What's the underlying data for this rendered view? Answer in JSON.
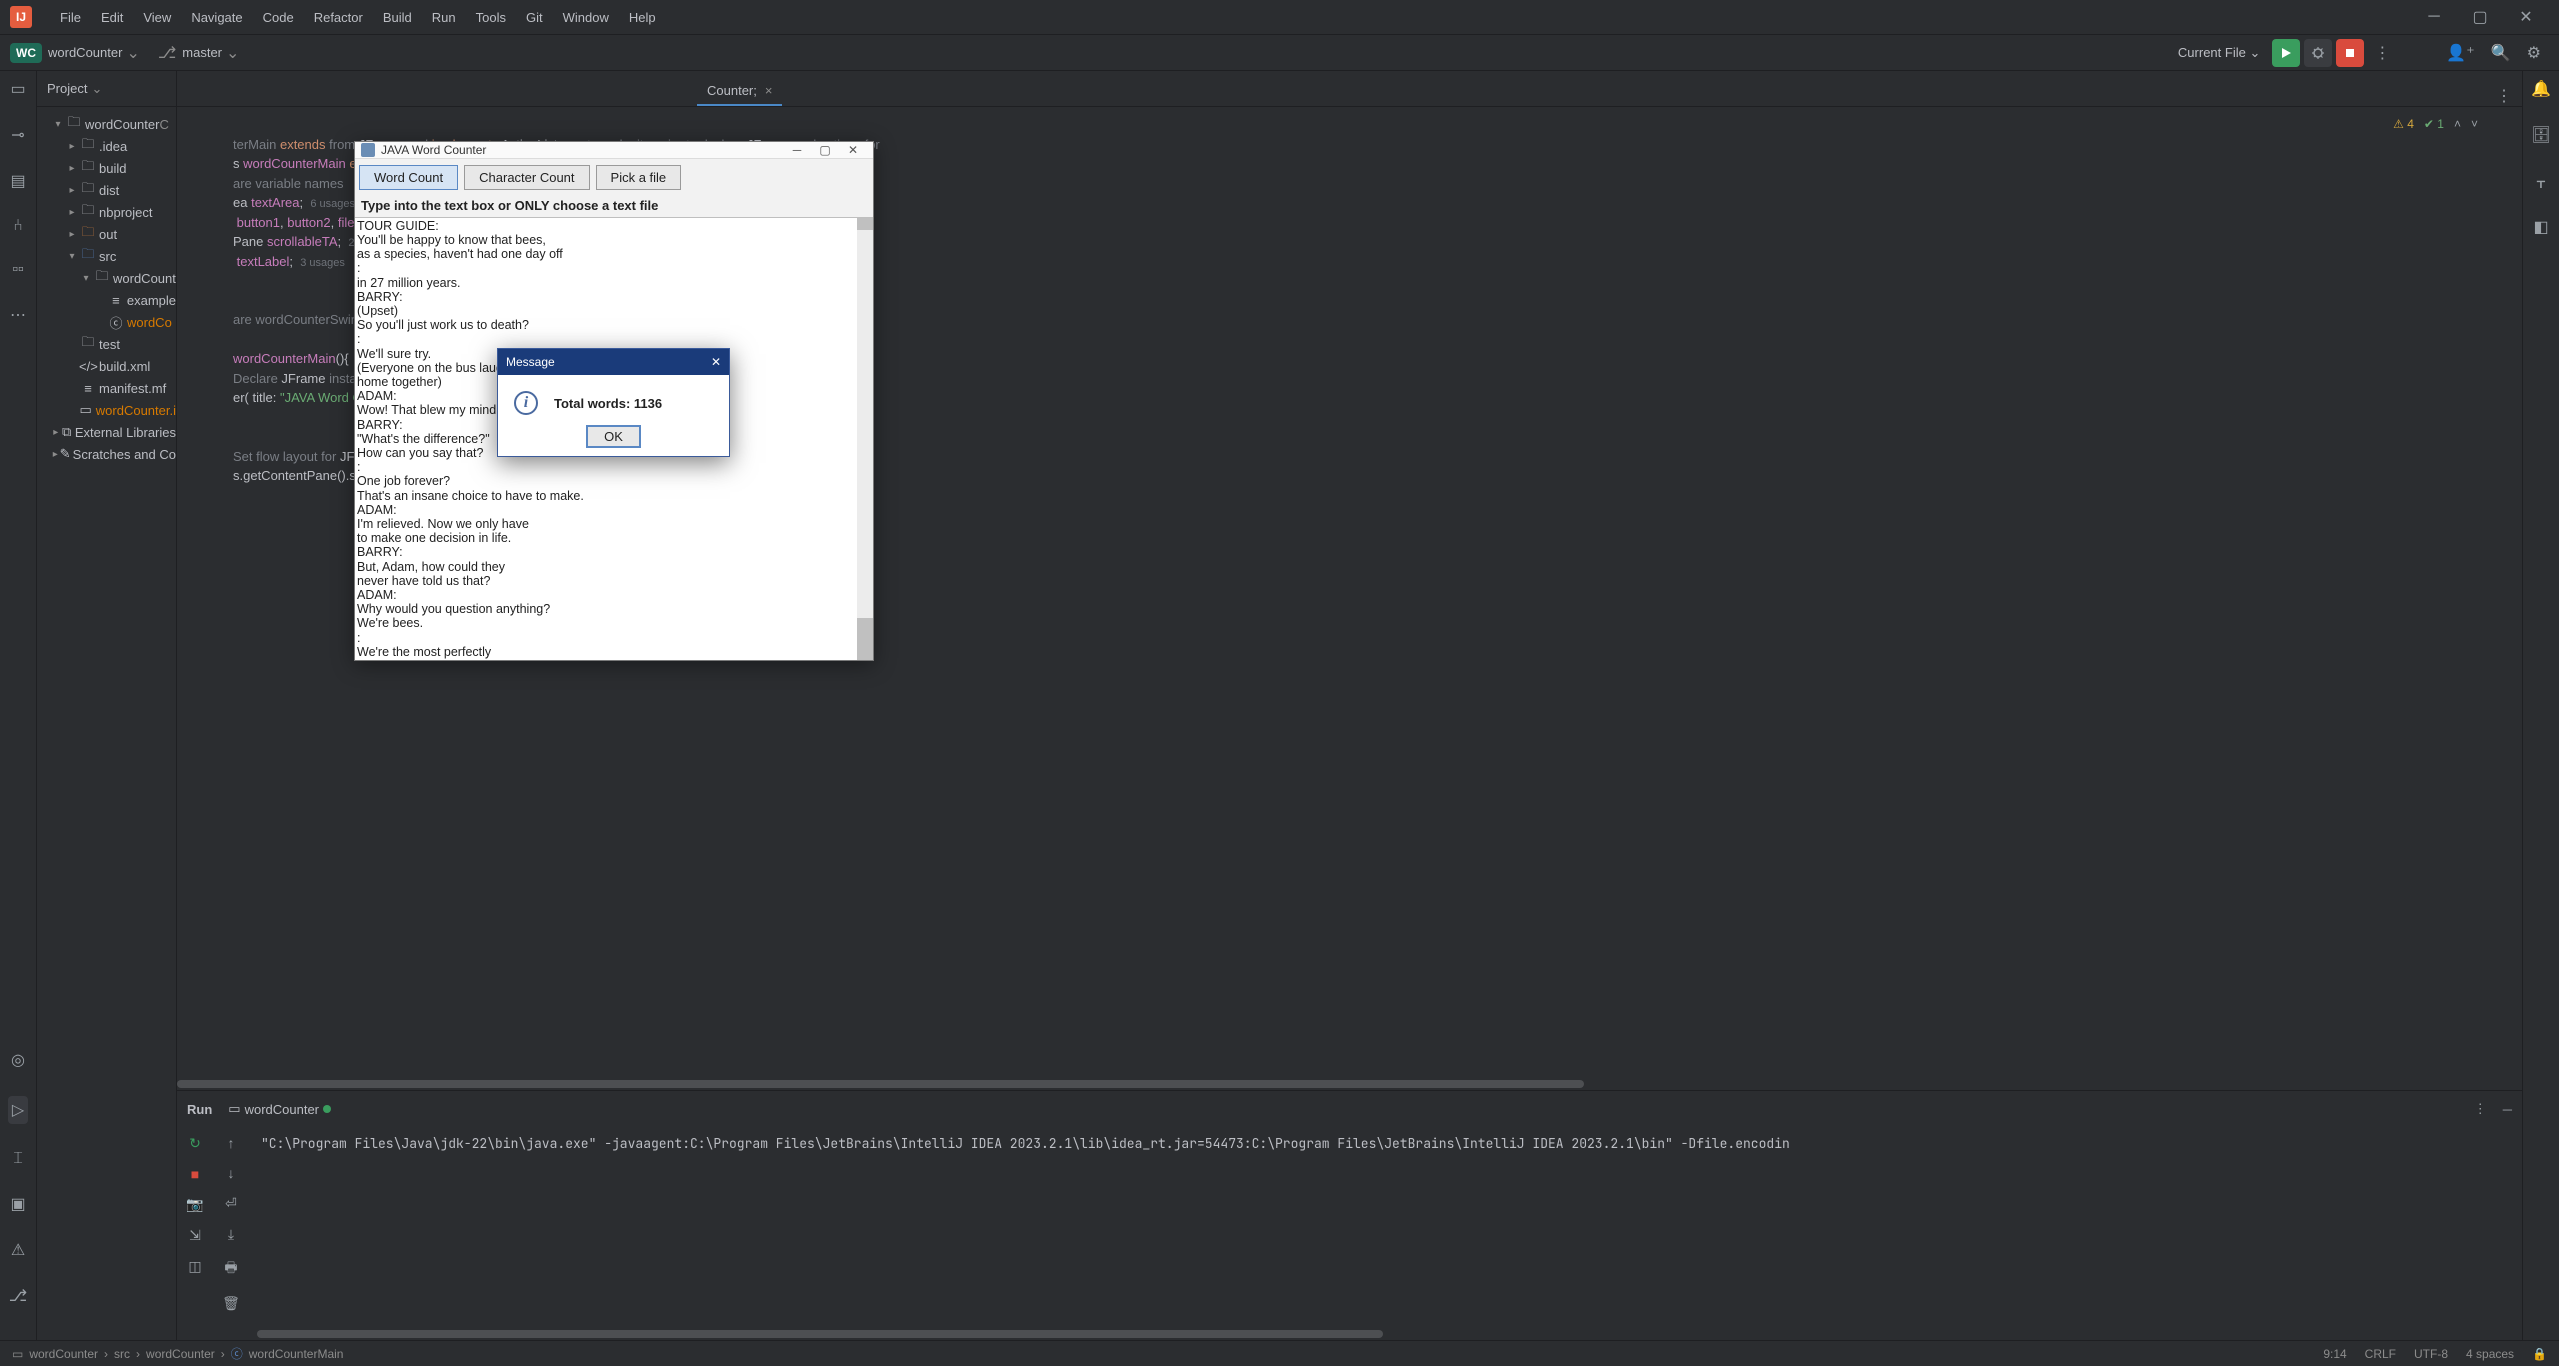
{
  "menubar": {
    "items": [
      "File",
      "Edit",
      "View",
      "Navigate",
      "Code",
      "Refactor",
      "Build",
      "Run",
      "Tools",
      "Git",
      "Window",
      "Help"
    ]
  },
  "toolbar": {
    "project_badge": "WC",
    "project_name": "wordCounter",
    "branch_name": "master",
    "run_config": "Current File"
  },
  "project_panel": {
    "title": "Project",
    "tree": {
      "root": "wordCounter",
      "items": [
        {
          "indent": 1,
          "arrow": "▾",
          "icon": "folder",
          "label": "wordCounter",
          "suffix": "C"
        },
        {
          "indent": 2,
          "arrow": "▸",
          "icon": "folder",
          "label": ".idea"
        },
        {
          "indent": 2,
          "arrow": "▸",
          "icon": "folder",
          "label": "build"
        },
        {
          "indent": 2,
          "arrow": "▸",
          "icon": "folder",
          "label": "dist"
        },
        {
          "indent": 2,
          "arrow": "▸",
          "icon": "folder",
          "label": "nbproject"
        },
        {
          "indent": 2,
          "arrow": "▸",
          "icon": "out",
          "label": "out"
        },
        {
          "indent": 2,
          "arrow": "▾",
          "icon": "src",
          "label": "src"
        },
        {
          "indent": 3,
          "arrow": "▾",
          "icon": "folder",
          "label": "wordCount"
        },
        {
          "indent": 4,
          "arrow": "",
          "icon": "file",
          "label": "example"
        },
        {
          "indent": 4,
          "arrow": "",
          "icon": "class",
          "label": "wordCo",
          "cls": "orange"
        },
        {
          "indent": 2,
          "arrow": "",
          "icon": "folder",
          "label": "test"
        },
        {
          "indent": 2,
          "arrow": "",
          "icon": "xml",
          "label": "build.xml"
        },
        {
          "indent": 2,
          "arrow": "",
          "icon": "file",
          "label": "manifest.mf"
        },
        {
          "indent": 2,
          "arrow": "",
          "icon": "iml",
          "label": "wordCounter.i",
          "cls": "orange"
        },
        {
          "indent": 1,
          "arrow": "▸",
          "icon": "lib",
          "label": "External Libraries"
        },
        {
          "indent": 1,
          "arrow": "▸",
          "icon": "scratch",
          "label": "Scratches and Co"
        }
      ]
    }
  },
  "editor": {
    "tab_label": "Counter;",
    "tab_close": "×",
    "warn_count": "4",
    "ok_count": "1",
    "code_lines": [
      "",
      "terMain extends from JFrame and implements ActionListener to make it easier to declare JFrame and actions for",
      "s wordCounterMain extends JFrame implements ActionListener{   ≡ echoblu",
      "are variable names",
      "ea textArea;  6 usages",
      " button1, button2, fileButton;  5 usages",
      "Pane scrollableTA;  2 usages",
      " textLabel;  3 usages",
      "",
      "",
      "are wordCounterSwing",
      "",
      "wordCounterMain(){  1 usage  ≡ echoblu",
      "Declare JFrame instance using super",
      "er( title: \"JAVA Word Counter\");",
      "",
      "",
      "Set flow layout for JFrame",
      "s.getContentPane().setLayout(new FlowLayout(FlowLayout.LEFT));"
    ]
  },
  "run": {
    "label": "Run",
    "target": "wordCounter",
    "console_line": "\"C:\\Program Files\\Java\\jdk-22\\bin\\java.exe\" -javaagent:C:\\Program Files\\JetBrains\\IntelliJ IDEA 2023.2.1\\lib\\idea_rt.jar=54473:C:\\Program Files\\JetBrains\\IntelliJ IDEA 2023.2.1\\bin\" -Dfile.encodin"
  },
  "statusbar": {
    "crumb1": "wordCounter",
    "crumb2": "src",
    "crumb3": "wordCounter",
    "crumb4": "wordCounterMain",
    "cursor": "9:14",
    "eol": "CRLF",
    "encoding": "UTF-8",
    "indent": "4 spaces"
  },
  "swing": {
    "title": "JAVA Word Counter",
    "buttons": {
      "word_count": "Word Count",
      "char_count": "Character Count",
      "pick_file": "Pick a file"
    },
    "label": "Type into the text box or ONLY choose a text file",
    "textarea": "TOUR GUIDE:\nYou'll be happy to know that bees,\nas a species, haven't had one day off\n:\nin 27 million years.\nBARRY:\n(Upset)\nSo you'll just work us to death?\n:\nWe'll sure try.\n(Everyone on the bus laughs\nhome together)\nADAM:\nWow! That blew my mind!\nBARRY:\n\"What's the difference?\"\nHow can you say that?\n:\nOne job forever?\nThat's an insane choice to have to make.\nADAM:\nI'm relieved. Now we only have\nto make one decision in life.\nBARRY:\nBut, Adam, how could they\nnever have told us that?\nADAM:\nWhy would you question anything?\nWe're bees.\n:\nWe're the most perfectly"
  },
  "dialog": {
    "title": "Message",
    "text": "Total words: 1136",
    "ok": "OK"
  }
}
